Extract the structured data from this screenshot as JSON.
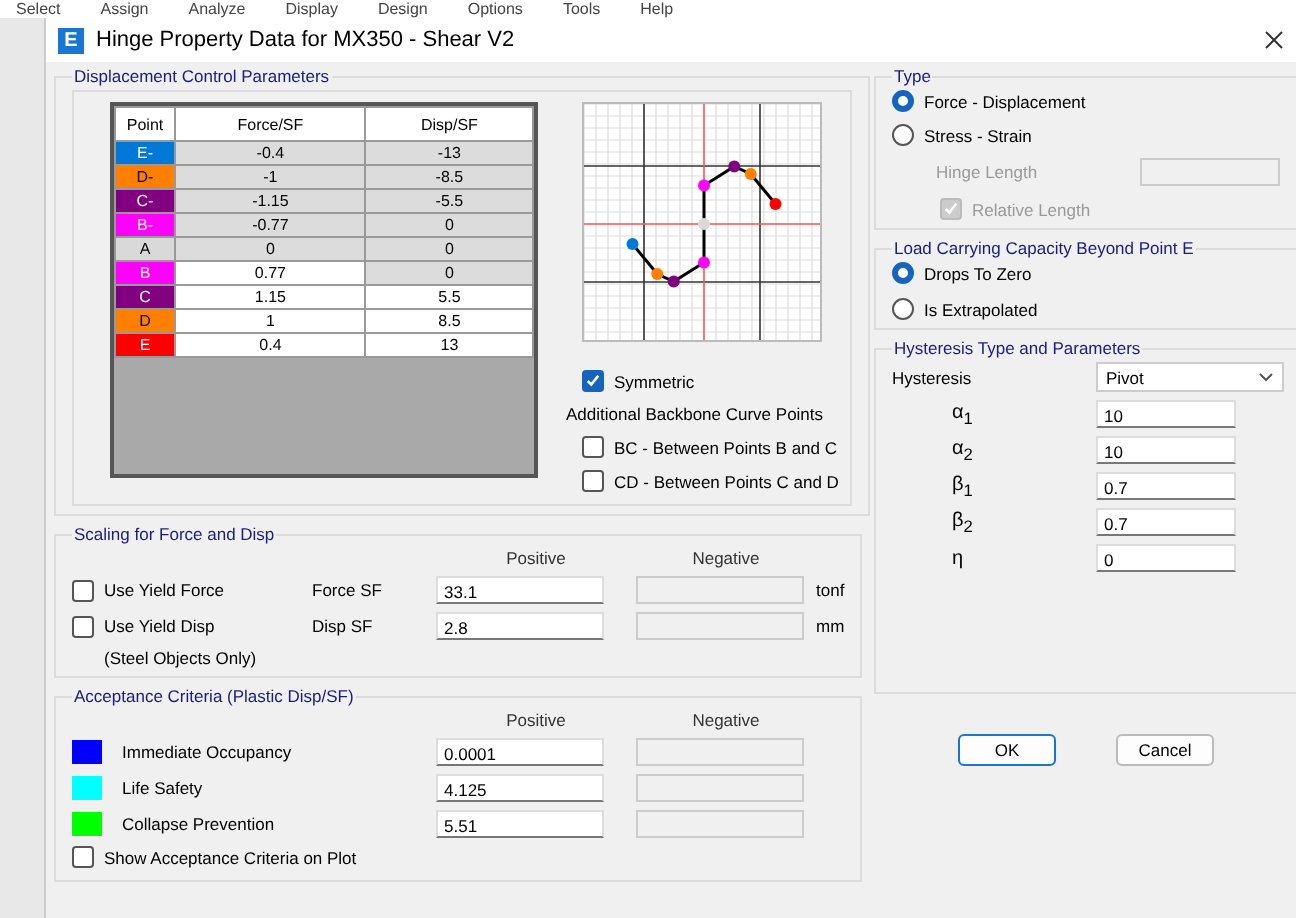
{
  "menu_bar": [
    "Select",
    "Assign",
    "Analyze",
    "Display",
    "Design",
    "Options",
    "Tools",
    "Help"
  ],
  "window": {
    "title": "Hinge Property Data for MX350 - Shear V2",
    "app_letter": "E"
  },
  "displacement_control": {
    "title": "Displacement Control Parameters",
    "table": {
      "columns": [
        "Point",
        "Force/SF",
        "Disp/SF"
      ],
      "rows": [
        {
          "point": "E-",
          "color": "#0078d7",
          "force": "-0.4",
          "disp": "-13",
          "force_editable": false,
          "disp_editable": false
        },
        {
          "point": "D-",
          "color": "#ff8000",
          "force": "-1",
          "disp": "-8.5",
          "force_editable": false,
          "disp_editable": false
        },
        {
          "point": "C-",
          "color": "#800080",
          "force": "-1.15",
          "disp": "-5.5",
          "force_editable": false,
          "disp_editable": false
        },
        {
          "point": "B-",
          "color": "#ff00ff",
          "force": "-0.77",
          "disp": "0",
          "force_editable": false,
          "disp_editable": false
        },
        {
          "point": "A",
          "color": "#d9d9d9",
          "force": "0",
          "disp": "0",
          "force_editable": false,
          "disp_editable": false
        },
        {
          "point": "B",
          "color": "#ff00ff",
          "force": "0.77",
          "disp": "0",
          "force_editable": true,
          "disp_editable": false
        },
        {
          "point": "C",
          "color": "#800080",
          "force": "1.15",
          "disp": "5.5",
          "force_editable": true,
          "disp_editable": true
        },
        {
          "point": "D",
          "color": "#ff8000",
          "force": "1",
          "disp": "8.5",
          "force_editable": true,
          "disp_editable": true
        },
        {
          "point": "E",
          "color": "#ff0000",
          "force": "0.4",
          "disp": "13",
          "force_editable": true,
          "disp_editable": true
        }
      ]
    },
    "symmetric": {
      "label": "Symmetric",
      "checked": true
    },
    "backbone": {
      "title": "Additional Backbone Curve Points",
      "options": [
        {
          "label": "BC - Between Points B and C",
          "checked": false
        },
        {
          "label": "CD - Between Points C and D",
          "checked": false
        }
      ]
    }
  },
  "scaling": {
    "title": "Scaling for Force and Disp",
    "columns": [
      "Positive",
      "Negative"
    ],
    "rows": [
      {
        "label": "Use Yield Force",
        "checked": false,
        "field_label": "Force SF",
        "positive": "33.1",
        "unit": "tonf"
      },
      {
        "label": "Use Yield Disp",
        "note": "(Steel Objects Only)",
        "checked": false,
        "field_label": "Disp SF",
        "positive": "2.8",
        "unit": "mm"
      }
    ]
  },
  "acceptance": {
    "title": "Acceptance Criteria (Plastic Disp/SF)",
    "columns": [
      "Positive",
      "Negative"
    ],
    "rows": [
      {
        "label": "Immediate Occupancy",
        "color": "#0000ff",
        "positive": "0.0001"
      },
      {
        "label": "Life Safety",
        "color": "#00ffff",
        "positive": "4.125"
      },
      {
        "label": "Collapse Prevention",
        "color": "#00ff00",
        "positive": "5.51"
      }
    ],
    "show_on_plot": {
      "label": "Show Acceptance Criteria on Plot",
      "checked": false
    }
  },
  "type": {
    "title": "Type",
    "options": [
      {
        "label": "Force - Displacement",
        "selected": true
      },
      {
        "label": "Stress - Strain",
        "selected": false
      }
    ],
    "hinge_length_label": "Hinge Length",
    "relative_length": {
      "label": "Relative Length",
      "checked": true,
      "disabled": true
    }
  },
  "load_capacity": {
    "title": "Load Carrying Capacity Beyond Point E",
    "options": [
      {
        "label": "Drops To Zero",
        "selected": true
      },
      {
        "label": "Is Extrapolated",
        "selected": false
      }
    ]
  },
  "hysteresis": {
    "title": "Hysteresis Type and Parameters",
    "type_label": "Hysteresis",
    "type_value": "Pivot",
    "params": [
      {
        "symbol": "α$_{1}$",
        "value": "10"
      },
      {
        "symbol": "α$_{2}$",
        "value": "10"
      },
      {
        "symbol": "β$_{1}$",
        "value": "0.7"
      },
      {
        "symbol": "β$_{2}$",
        "value": "0.7"
      },
      {
        "symbol": "η",
        "value": "0"
      }
    ]
  },
  "buttons": [
    {
      "label": "OK",
      "default": true
    },
    {
      "label": "Cancel",
      "default": false
    }
  ]
}
